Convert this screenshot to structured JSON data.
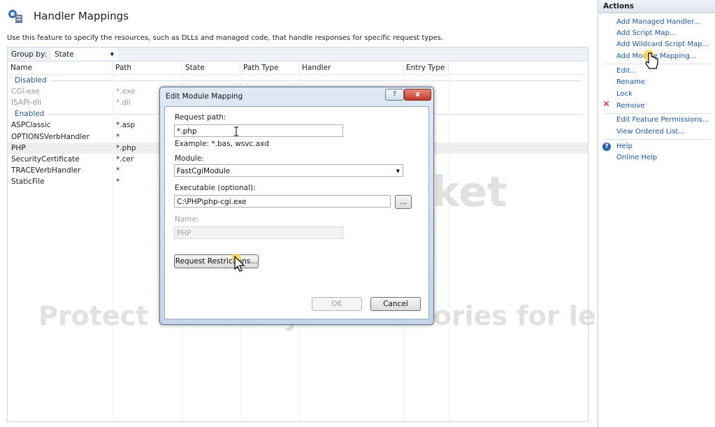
{
  "header": {
    "title": "Handler Mappings",
    "description": "Use this feature to specify the resources, such as DLLs and managed code, that handle responses for specific request types."
  },
  "groupby": {
    "label": "Group by:",
    "value": "State"
  },
  "columns": [
    "Name",
    "Path",
    "State",
    "Path Type",
    "Handler",
    "Entry Type"
  ],
  "groups": {
    "disabled": "Disabled",
    "enabled": "Enabled"
  },
  "rows_disabled": [
    {
      "name": "CGI-exe",
      "path": "*.exe"
    },
    {
      "name": "ISAPI-dll",
      "path": "*.dll"
    }
  ],
  "rows_enabled": [
    {
      "name": "ASPClassic",
      "path": "*.asp"
    },
    {
      "name": "OPTIONSVerbHandler",
      "path": "*"
    },
    {
      "name": "PHP",
      "path": "*.php"
    },
    {
      "name": "SecurityCertificate",
      "path": "*.cer"
    },
    {
      "name": "TRACEVerbHandler",
      "path": "*"
    },
    {
      "name": "StaticFile",
      "path": "*"
    }
  ],
  "watermark": {
    "line1": "photobucket",
    "line2": "Protect more of your memories for less!"
  },
  "actions": {
    "title": "Actions",
    "add_managed": "Add Managed Handler...",
    "add_script": "Add Script Map...",
    "add_wildcard": "Add Wildcard Script Map...",
    "add_module": "Add Module Mapping...",
    "edit": "Edit...",
    "rename": "Rename",
    "lock": "Lock",
    "remove": "Remove",
    "edit_feature_permissions": "Edit Feature Permissions...",
    "view_ordered_list": "View Ordered List...",
    "help": "Help",
    "online_help": "Online Help"
  },
  "dialog": {
    "title": "Edit Module Mapping",
    "help_btn": "?",
    "close_btn": "x",
    "request_path_label": "Request path:",
    "request_path_value": "*.php",
    "example": "Example: *.bas, wsvc.axd",
    "module_label": "Module:",
    "module_value": "FastCgiModule",
    "executable_label": "Executable (optional):",
    "executable_value": "C:\\PHP\\php-cgi.exe",
    "browse_btn": "...",
    "name_label": "Name:",
    "name_value": "PHP",
    "request_restrictions_btn": "Request Restrictions...",
    "ok_btn": "OK",
    "cancel_btn": "Cancel"
  }
}
